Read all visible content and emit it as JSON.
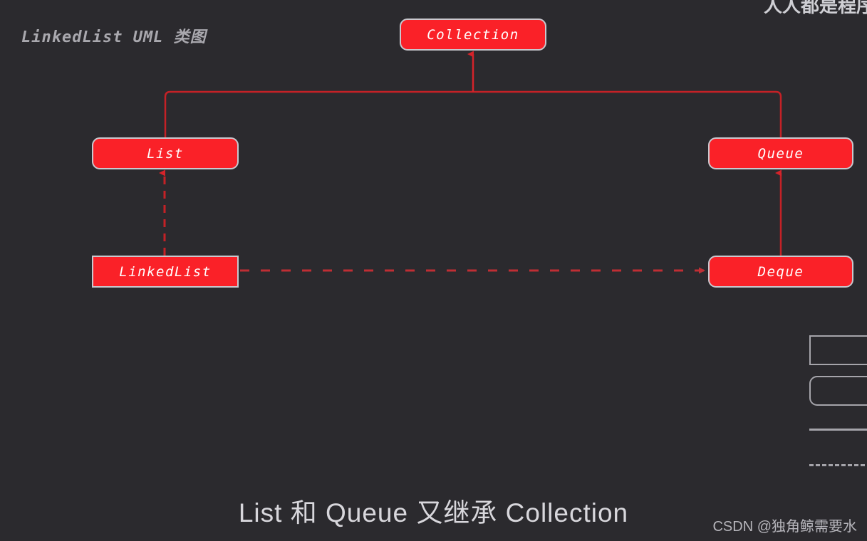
{
  "diagram": {
    "title": "LinkedList UML 类图",
    "caption": "List 和 Queue 又继承 Collection",
    "background_color": "#2b2a2e",
    "node_fill_color": "#fa2128",
    "node_border_color": "#c9c8ce",
    "connector_color": "#c42126",
    "nodes": [
      {
        "id": "collection",
        "label": "Collection",
        "kind": "interface",
        "shape": "rounded-rect"
      },
      {
        "id": "list",
        "label": "List",
        "kind": "interface",
        "shape": "rounded-rect"
      },
      {
        "id": "queue",
        "label": "Queue",
        "kind": "interface",
        "shape": "rounded-rect"
      },
      {
        "id": "linkedlist",
        "label": "LinkedList",
        "kind": "class",
        "shape": "rect"
      },
      {
        "id": "deque",
        "label": "Deque",
        "kind": "interface",
        "shape": "rounded-rect"
      }
    ],
    "edges": [
      {
        "id": "list-to-collection",
        "from": "list",
        "to": "collection",
        "style": "solid",
        "relation": "extends"
      },
      {
        "id": "queue-to-collection",
        "from": "queue",
        "to": "collection",
        "style": "solid",
        "relation": "extends"
      },
      {
        "id": "linkedlist-to-list",
        "from": "linkedlist",
        "to": "list",
        "style": "dashed",
        "relation": "implements"
      },
      {
        "id": "deque-to-queue",
        "from": "deque",
        "to": "queue",
        "style": "solid",
        "relation": "extends"
      },
      {
        "id": "linkedlist-to-deque",
        "from": "linkedlist",
        "to": "deque",
        "style": "dashed",
        "relation": "implements"
      }
    ]
  },
  "legend": {
    "items": [
      {
        "id": "class",
        "swatch": "rect"
      },
      {
        "id": "interface",
        "swatch": "rounded-rect"
      },
      {
        "id": "extends",
        "swatch": "solid-line"
      },
      {
        "id": "implements",
        "swatch": "dashed-line"
      }
    ]
  },
  "watermarks": {
    "top_right": "人人都是程序",
    "bottom_right": "CSDN @独角鲸需要水"
  }
}
